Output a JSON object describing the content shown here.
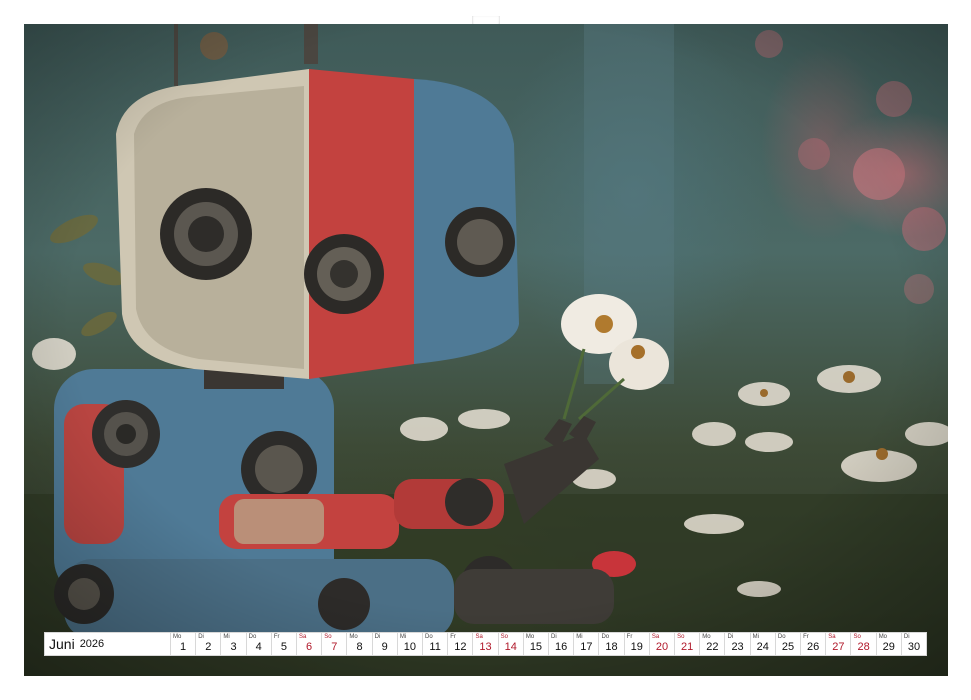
{
  "calendar": {
    "month": "Juni",
    "year": "2026",
    "days": [
      {
        "dow": "Mo",
        "num": "1",
        "type": "weekday"
      },
      {
        "dow": "Di",
        "num": "2",
        "type": "weekday"
      },
      {
        "dow": "Mi",
        "num": "3",
        "type": "weekday"
      },
      {
        "dow": "Do",
        "num": "4",
        "type": "weekday"
      },
      {
        "dow": "Fr",
        "num": "5",
        "type": "weekday"
      },
      {
        "dow": "Sa",
        "num": "6",
        "type": "saturday"
      },
      {
        "dow": "So",
        "num": "7",
        "type": "sunday"
      },
      {
        "dow": "Mo",
        "num": "8",
        "type": "weekday"
      },
      {
        "dow": "Di",
        "num": "9",
        "type": "weekday"
      },
      {
        "dow": "Mi",
        "num": "10",
        "type": "weekday"
      },
      {
        "dow": "Do",
        "num": "11",
        "type": "weekday"
      },
      {
        "dow": "Fr",
        "num": "12",
        "type": "weekday"
      },
      {
        "dow": "Sa",
        "num": "13",
        "type": "saturday"
      },
      {
        "dow": "So",
        "num": "14",
        "type": "sunday"
      },
      {
        "dow": "Mo",
        "num": "15",
        "type": "weekday"
      },
      {
        "dow": "Di",
        "num": "16",
        "type": "weekday"
      },
      {
        "dow": "Mi",
        "num": "17",
        "type": "weekday"
      },
      {
        "dow": "Do",
        "num": "18",
        "type": "weekday"
      },
      {
        "dow": "Fr",
        "num": "19",
        "type": "weekday"
      },
      {
        "dow": "Sa",
        "num": "20",
        "type": "saturday"
      },
      {
        "dow": "So",
        "num": "21",
        "type": "sunday"
      },
      {
        "dow": "Mo",
        "num": "22",
        "type": "weekday"
      },
      {
        "dow": "Di",
        "num": "23",
        "type": "weekday"
      },
      {
        "dow": "Mi",
        "num": "24",
        "type": "weekday"
      },
      {
        "dow": "Do",
        "num": "25",
        "type": "weekday"
      },
      {
        "dow": "Fr",
        "num": "26",
        "type": "weekday"
      },
      {
        "dow": "Sa",
        "num": "27",
        "type": "saturday"
      },
      {
        "dow": "So",
        "num": "28",
        "type": "sunday"
      },
      {
        "dow": "Mo",
        "num": "29",
        "type": "weekday"
      },
      {
        "dow": "Di",
        "num": "30",
        "type": "weekday"
      }
    ]
  },
  "colors": {
    "weekend": "#b0182a",
    "robot_red": "#c3423f",
    "robot_blue": "#4f7a96"
  }
}
